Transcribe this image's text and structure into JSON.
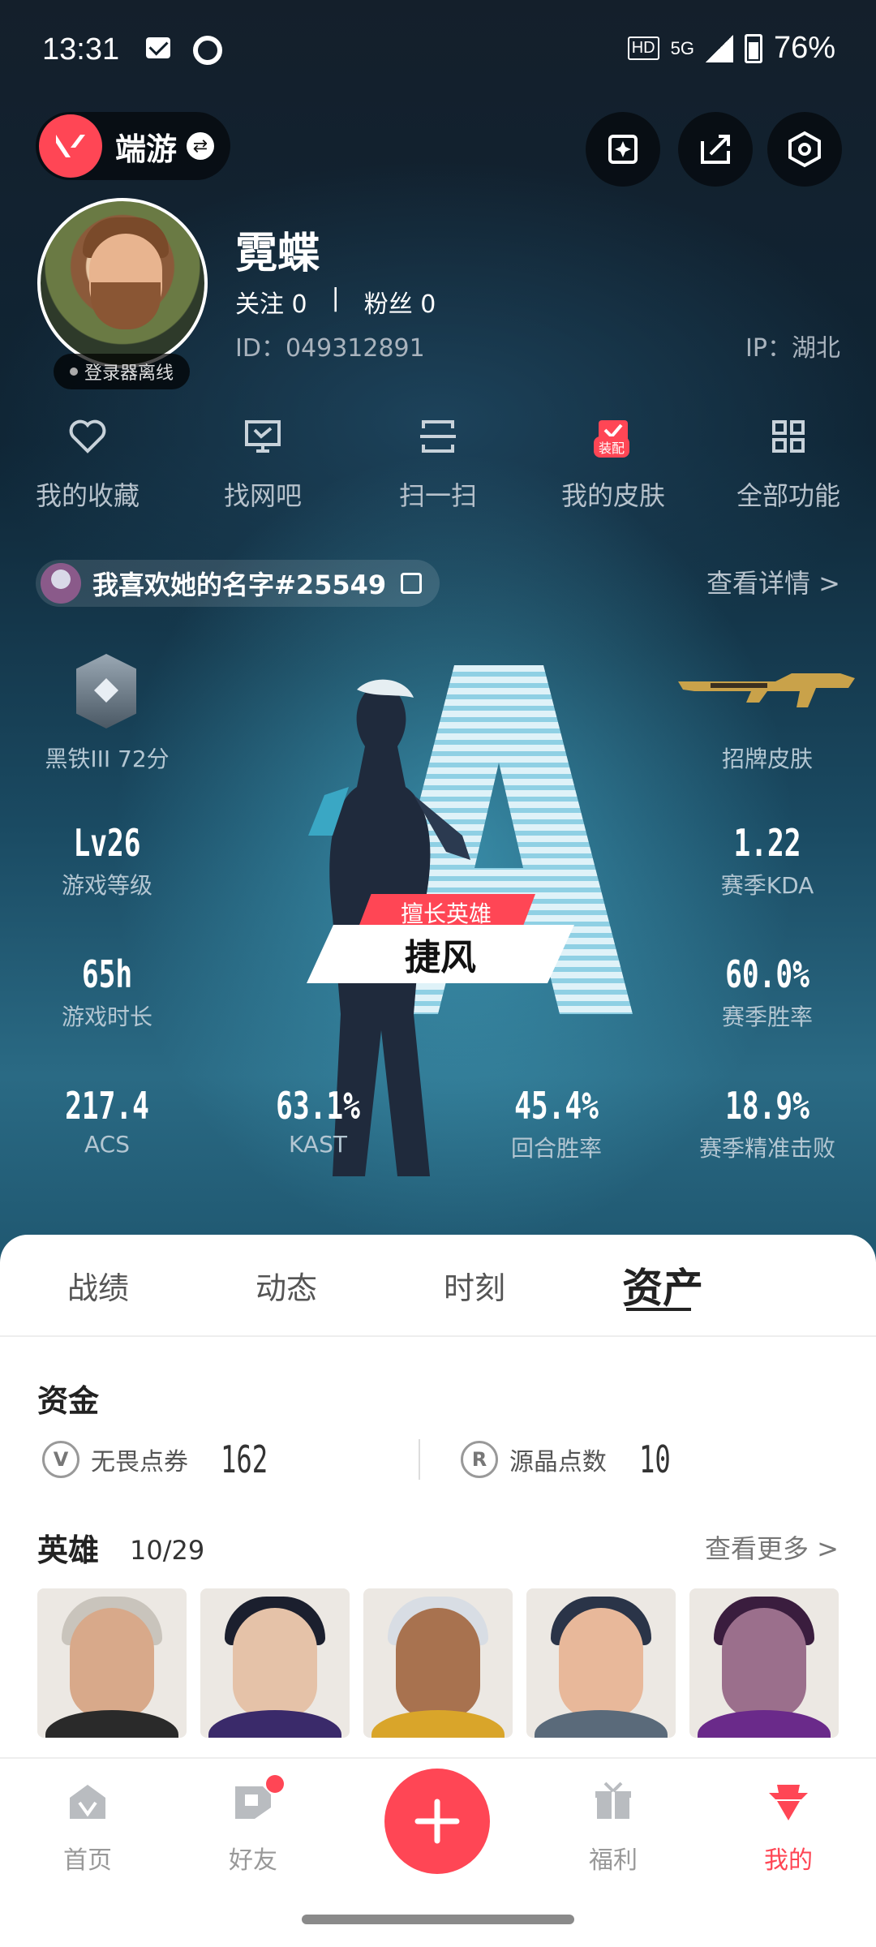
{
  "status_bar": {
    "time": "13:31",
    "network": "5G",
    "battery": "76%"
  },
  "header": {
    "mode_label": "端游"
  },
  "profile": {
    "username": "霓蝶",
    "follow_label": "关注 0",
    "separator": "|",
    "fans_label": "粉丝 0",
    "id": "ID：049312891",
    "ip": "IP：湖北",
    "status": "登录器离线"
  },
  "functions": [
    {
      "label": "我的收藏",
      "icon": "heart-icon"
    },
    {
      "label": "找网吧",
      "icon": "monitor-icon"
    },
    {
      "label": "扫一扫",
      "icon": "scan-icon"
    },
    {
      "label": "我的皮肤",
      "icon": "skin-icon",
      "badge": "装配"
    },
    {
      "label": "全部功能",
      "icon": "grid-icon"
    }
  ],
  "riot": {
    "name": "我喜欢她的名字#25549",
    "detail": "查看详情 >"
  },
  "stats": {
    "rank": "黑铁III 72分",
    "skin": "招牌皮肤",
    "level_value": "Lv26",
    "level_label": "游戏等级",
    "kda_value": "1.22",
    "kda_label": "赛季KDA",
    "hours_value": "65h",
    "hours_label": "游戏时长",
    "winrate_value": "60.0%",
    "winrate_label": "赛季胜率",
    "acs_value": "217.4",
    "acs_label": "ACS",
    "kast_value": "63.1%",
    "kast_label": "KAST",
    "round_value": "45.4%",
    "round_label": "回合胜率",
    "hs_value": "18.9%",
    "hs_label": "赛季精准击败",
    "top_agent_tag": "擅长英雄",
    "top_agent_name": "捷风"
  },
  "tabs": [
    "战绩",
    "动态",
    "时刻",
    "资产"
  ],
  "active_tab": "资产",
  "funds": {
    "title": "资金",
    "vp_label": "无畏点券",
    "vp_value": "162",
    "rp_label": "源晶点数",
    "rp_value": "10"
  },
  "heroes": {
    "title": "英雄",
    "count": "10/29",
    "more": "查看更多 >"
  },
  "nav": [
    {
      "label": "首页"
    },
    {
      "label": "好友"
    },
    {
      "label": "福利"
    },
    {
      "label": "我的"
    }
  ],
  "colors": {
    "accent": "#ff4655"
  }
}
